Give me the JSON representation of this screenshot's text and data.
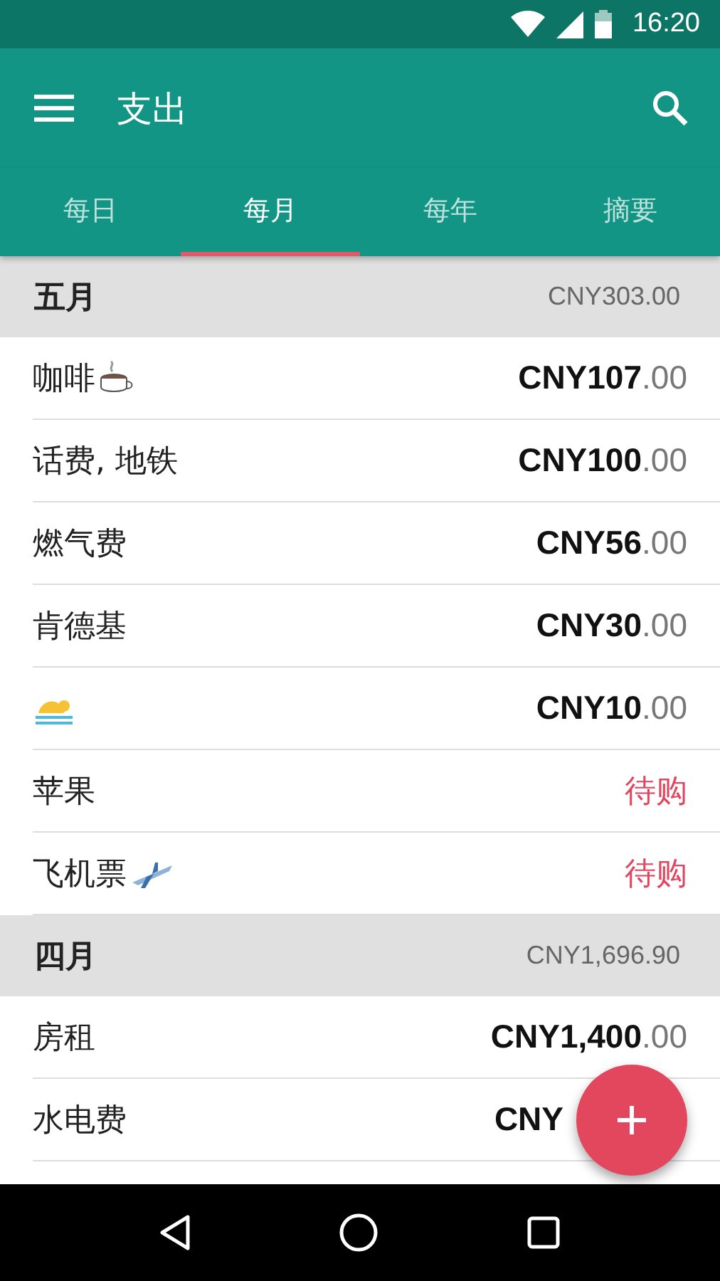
{
  "status_bar": {
    "time": "16:20"
  },
  "app_bar": {
    "title": "支出"
  },
  "tabs": [
    {
      "label": "每日",
      "selected": false
    },
    {
      "label": "每月",
      "selected": true
    },
    {
      "label": "每年",
      "selected": false
    },
    {
      "label": "摘要",
      "selected": false
    }
  ],
  "sections": [
    {
      "month": "五月",
      "total": "CNY303.00",
      "items": [
        {
          "kind": "amount",
          "name": "咖啡",
          "emoji": {
            "kind": "cup"
          },
          "amount": "CNY107",
          "decimal": ".00"
        },
        {
          "kind": "amount",
          "name": "话费, 地铁",
          "amount": "CNY100",
          "decimal": ".00"
        },
        {
          "kind": "amount",
          "name": "燃气费",
          "amount": "CNY56",
          "decimal": ".00"
        },
        {
          "kind": "amount",
          "name": "肯德基",
          "amount": "CNY30",
          "decimal": ".00"
        },
        {
          "kind": "amount",
          "emoji": {
            "kind": "swim"
          },
          "amount": "CNY10",
          "decimal": ".00"
        },
        {
          "kind": "status",
          "name": "苹果",
          "status": "待购"
        },
        {
          "kind": "status",
          "name": "飞机票",
          "emoji": {
            "kind": "plane"
          },
          "status": "待购"
        }
      ]
    },
    {
      "month": "四月",
      "total": "CNY1,696.90",
      "items": [
        {
          "kind": "amount",
          "name": "房租",
          "amount": "CNY1,400",
          "decimal": ".00"
        },
        {
          "kind": "amount",
          "name": "水电费",
          "amount": "CNY"
        }
      ]
    }
  ]
}
